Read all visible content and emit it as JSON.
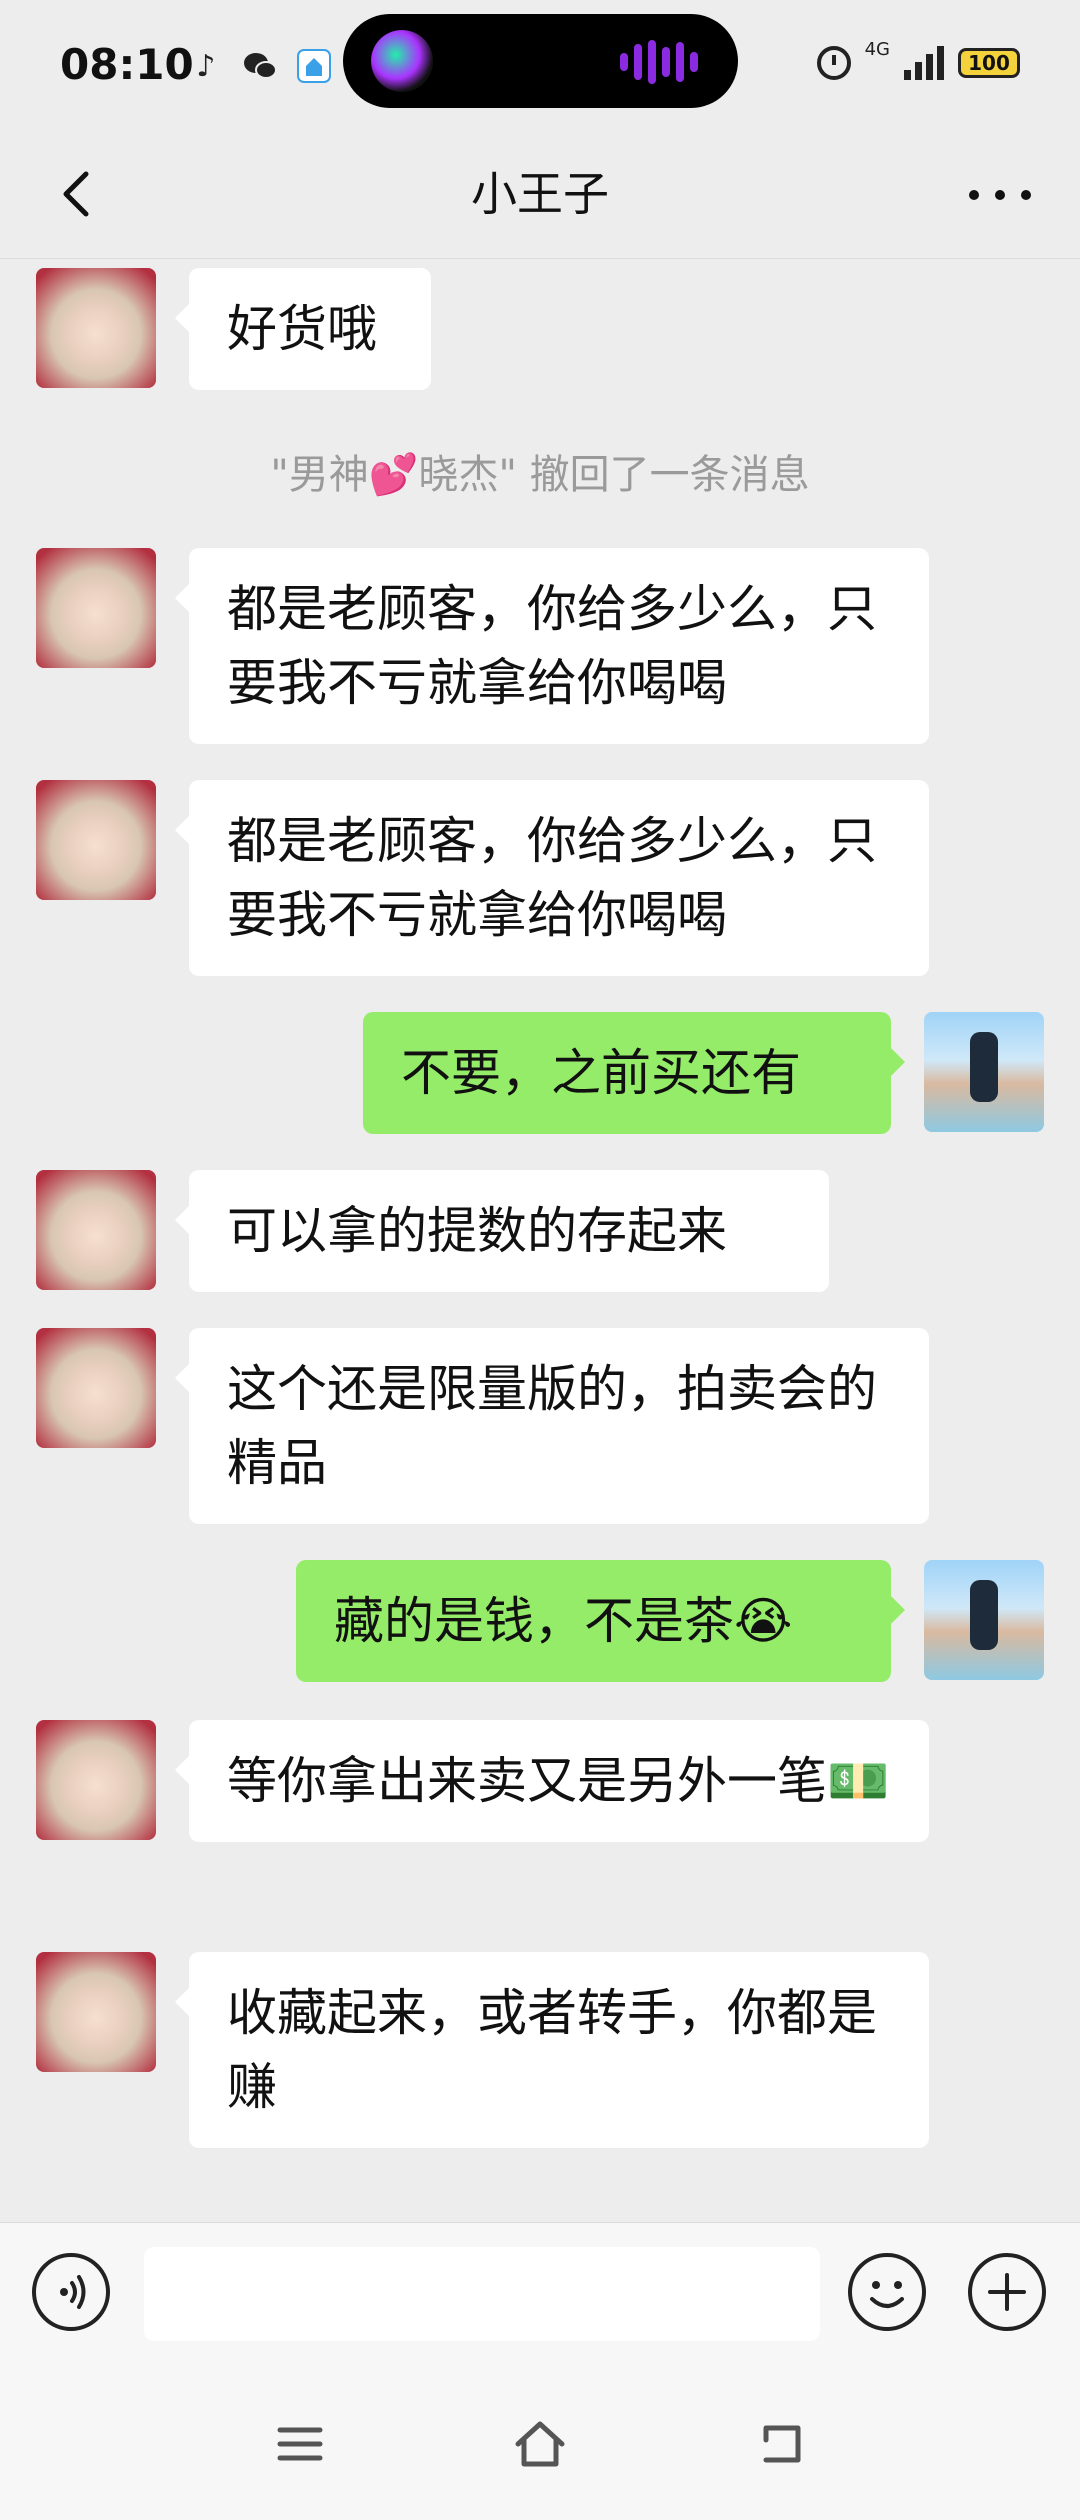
{
  "status_bar": {
    "time": "08:10",
    "network": "4G",
    "battery": "100"
  },
  "header": {
    "title": "小王子"
  },
  "messages": [
    {
      "sender": "other",
      "text": "好货哦"
    },
    {
      "type": "system",
      "text": "\"男神💕晓杰\" 撤回了一条消息"
    },
    {
      "sender": "other",
      "text": "都是老顾客，你给多少么，只要我不亏就拿给你喝喝"
    },
    {
      "sender": "other",
      "text": "都是老顾客，你给多少么，只要我不亏就拿给你喝喝"
    },
    {
      "sender": "self",
      "text": "不要，之前买还有"
    },
    {
      "sender": "other",
      "text": "可以拿的提数的存起来"
    },
    {
      "sender": "other",
      "text": "这个还是限量版的，拍卖会的精品"
    },
    {
      "sender": "self",
      "text": "藏的是钱，不是茶😭"
    },
    {
      "sender": "other",
      "text": "等你拿出来卖又是另外一笔💵"
    },
    {
      "sender": "other",
      "text": "收藏起来，或者转手，你都是赚"
    }
  ],
  "input": {
    "value": ""
  },
  "icons": {
    "back": "chevron-left-icon",
    "more": "more-horizontal-icon",
    "voice": "voice-icon",
    "emoji": "emoji-icon",
    "plus": "plus-icon"
  },
  "colors": {
    "background": "#ededed",
    "self_bubble": "#95ec69",
    "other_bubble": "#ffffff"
  }
}
